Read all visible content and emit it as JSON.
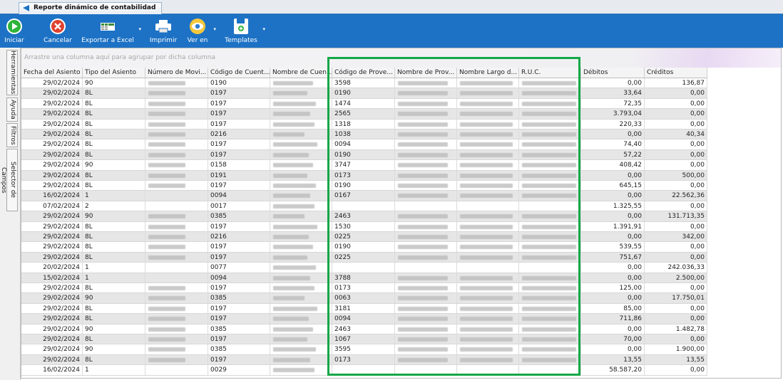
{
  "window": {
    "tab_title": "Reporte dinámico de contabilidad"
  },
  "toolbar": {
    "iniciar": "Iniciar",
    "cancelar": "Cancelar",
    "exportar": "Exportar a Excel",
    "imprimir": "Imprimir",
    "ver_en": "Ver en",
    "templates": "Templates"
  },
  "side_tabs": [
    "Herramientas",
    "Ayuda",
    "Filtros",
    "Selector de Campos"
  ],
  "grid": {
    "group_hint": "Arrastre una columna aquí para agrupar por dicha columna",
    "columns": [
      "Fecha del Asiento",
      "Tipo del Asiento",
      "Número de Movi...",
      "Código de Cuent...",
      "Nombre de Cuen...",
      "Código de Prove...",
      "Nombre de Prov...",
      "Nombre Largo d...",
      "R.U.C.",
      "Débitos",
      "Créditos"
    ],
    "rows": [
      {
        "fecha": "29/02/2024",
        "tipo": "90",
        "cuenta": "0190",
        "prov": "3598",
        "debitos": "0,00",
        "creditos": "136,87"
      },
      {
        "fecha": "29/02/2024",
        "tipo": "8L",
        "cuenta": "0197",
        "prov": "0190",
        "debitos": "33,64",
        "creditos": "0,00"
      },
      {
        "fecha": "29/02/2024",
        "tipo": "8L",
        "cuenta": "0197",
        "prov": "1474",
        "debitos": "72,35",
        "creditos": "0,00"
      },
      {
        "fecha": "29/02/2024",
        "tipo": "8L",
        "cuenta": "0197",
        "prov": "2565",
        "debitos": "3.793,04",
        "creditos": "0,00"
      },
      {
        "fecha": "29/02/2024",
        "tipo": "8L",
        "cuenta": "0197",
        "prov": "1318",
        "debitos": "220,33",
        "creditos": "0,00"
      },
      {
        "fecha": "29/02/2024",
        "tipo": "8L",
        "cuenta": "0216",
        "prov": "1038",
        "debitos": "0,00",
        "creditos": "40,34"
      },
      {
        "fecha": "29/02/2024",
        "tipo": "8L",
        "cuenta": "0197",
        "prov": "0094",
        "debitos": "74,40",
        "creditos": "0,00"
      },
      {
        "fecha": "29/02/2024",
        "tipo": "8L",
        "cuenta": "0197",
        "prov": "0190",
        "debitos": "57,22",
        "creditos": "0,00"
      },
      {
        "fecha": "29/02/2024",
        "tipo": "90",
        "cuenta": "0158",
        "prov": "3747",
        "debitos": "408,42",
        "creditos": "0,00"
      },
      {
        "fecha": "29/02/2024",
        "tipo": "8L",
        "cuenta": "0191",
        "prov": "0173",
        "debitos": "0,00",
        "creditos": "500,00"
      },
      {
        "fecha": "29/02/2024",
        "tipo": "8L",
        "cuenta": "0197",
        "prov": "0190",
        "debitos": "645,15",
        "creditos": "0,00"
      },
      {
        "fecha": "16/02/2024",
        "tipo": "1",
        "cuenta": "0094",
        "prov": "0167",
        "debitos": "0,00",
        "creditos": "22.562,36"
      },
      {
        "fecha": "07/02/2024",
        "tipo": "2",
        "cuenta": "0017",
        "prov": "",
        "debitos": "1.325,55",
        "creditos": "0,00"
      },
      {
        "fecha": "29/02/2024",
        "tipo": "90",
        "cuenta": "0385",
        "prov": "2463",
        "debitos": "0,00",
        "creditos": "131.713,35"
      },
      {
        "fecha": "29/02/2024",
        "tipo": "8L",
        "cuenta": "0197",
        "prov": "1530",
        "debitos": "1.391,91",
        "creditos": "0,00"
      },
      {
        "fecha": "29/02/2024",
        "tipo": "8L",
        "cuenta": "0216",
        "prov": "0225",
        "debitos": "0,00",
        "creditos": "342,00"
      },
      {
        "fecha": "29/02/2024",
        "tipo": "8L",
        "cuenta": "0197",
        "prov": "0190",
        "debitos": "539,55",
        "creditos": "0,00"
      },
      {
        "fecha": "29/02/2024",
        "tipo": "8L",
        "cuenta": "0197",
        "prov": "0225",
        "debitos": "751,67",
        "creditos": "0,00"
      },
      {
        "fecha": "20/02/2024",
        "tipo": "1",
        "cuenta": "0077",
        "prov": "",
        "debitos": "0,00",
        "creditos": "242.036,33"
      },
      {
        "fecha": "15/02/2024",
        "tipo": "1",
        "cuenta": "0094",
        "prov": "3788",
        "debitos": "0,00",
        "creditos": "2.500,00"
      },
      {
        "fecha": "29/02/2024",
        "tipo": "8L",
        "cuenta": "0197",
        "prov": "0173",
        "debitos": "125,00",
        "creditos": "0,00"
      },
      {
        "fecha": "29/02/2024",
        "tipo": "90",
        "cuenta": "0385",
        "prov": "0063",
        "debitos": "0,00",
        "creditos": "17.750,01"
      },
      {
        "fecha": "29/02/2024",
        "tipo": "8L",
        "cuenta": "0197",
        "prov": "3181",
        "debitos": "85,00",
        "creditos": "0,00"
      },
      {
        "fecha": "29/02/2024",
        "tipo": "8L",
        "cuenta": "0197",
        "prov": "0094",
        "debitos": "711,86",
        "creditos": "0,00"
      },
      {
        "fecha": "29/02/2024",
        "tipo": "90",
        "cuenta": "0385",
        "prov": "2463",
        "debitos": "0,00",
        "creditos": "1.482,78"
      },
      {
        "fecha": "29/02/2024",
        "tipo": "8L",
        "cuenta": "0197",
        "prov": "1067",
        "debitos": "70,00",
        "creditos": "0,00"
      },
      {
        "fecha": "29/02/2024",
        "tipo": "90",
        "cuenta": "0385",
        "prov": "3595",
        "debitos": "0,00",
        "creditos": "1.900,00"
      },
      {
        "fecha": "29/02/2024",
        "tipo": "8L",
        "cuenta": "0197",
        "prov": "0173",
        "debitos": "13,55",
        "creditos": "13,55"
      },
      {
        "fecha": "16/02/2024",
        "tipo": "1",
        "cuenta": "0029",
        "prov": "",
        "debitos": "58.587,20",
        "creditos": "0,00"
      }
    ]
  },
  "colors": {
    "ribbon": "#1d72c5",
    "highlight": "#14a748",
    "alt_row": "#e6e6e6"
  }
}
